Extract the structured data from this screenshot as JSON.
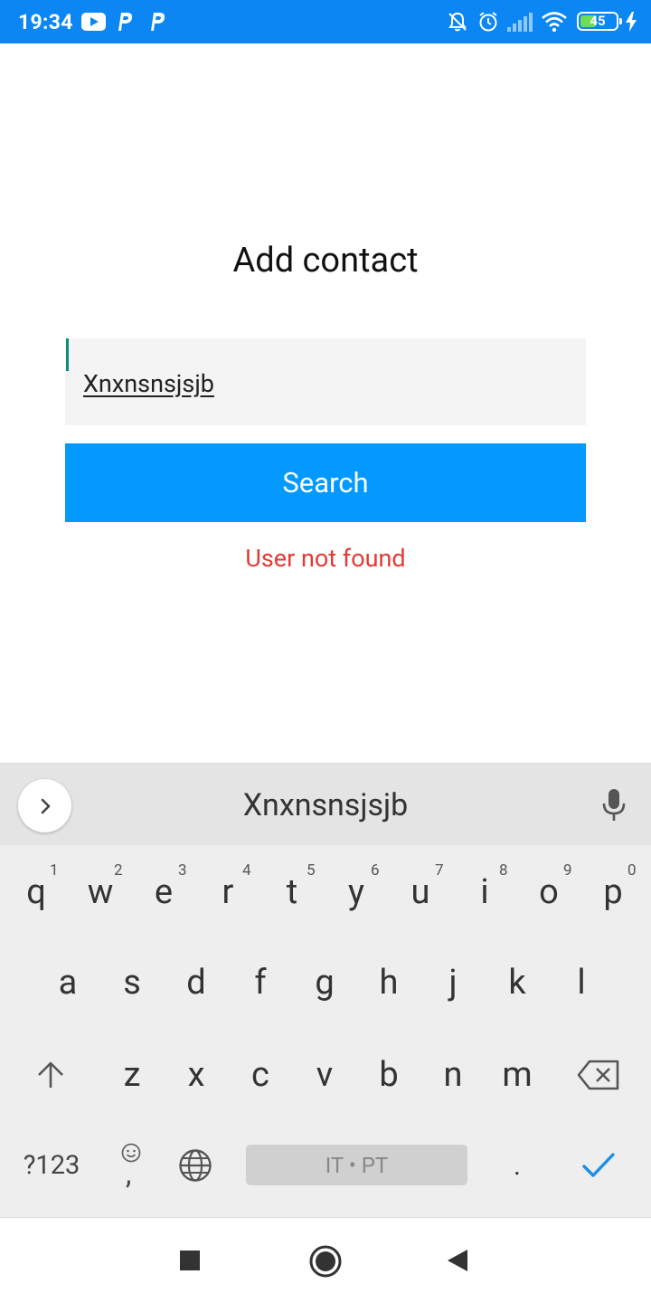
{
  "status_bar": {
    "time": "19:34",
    "battery_percent": "45",
    "battery_level": 0.45,
    "background_color": "#0b86f3",
    "icons": [
      "youtube-icon",
      "parking-p-icon",
      "parking-p-icon",
      "bell-off-icon",
      "alarm-clock-icon",
      "signal-icon",
      "wifi-icon",
      "battery-icon",
      "charging-bolt-icon"
    ]
  },
  "app": {
    "title": "Add contact",
    "search_input": {
      "value": "Xnxnsnsjsjb",
      "placeholder": ""
    },
    "search_button_label": "Search",
    "error_message": "User not found",
    "accent_color": "#0399fe",
    "error_color": "#e53935"
  },
  "keyboard": {
    "suggestion": "Xnxnsnsjsjb",
    "row1": [
      "q",
      "w",
      "e",
      "r",
      "t",
      "y",
      "u",
      "i",
      "o",
      "p"
    ],
    "row1_hints": [
      "1",
      "2",
      "3",
      "4",
      "5",
      "6",
      "7",
      "8",
      "9",
      "0"
    ],
    "row2": [
      "a",
      "s",
      "d",
      "f",
      "g",
      "h",
      "j",
      "k",
      "l"
    ],
    "row3": [
      "z",
      "x",
      "c",
      "v",
      "b",
      "n",
      "m"
    ],
    "symbols_label": "?123",
    "comma_label": ",",
    "spacebar_label": "IT • PT",
    "period_label": ".",
    "icons": [
      "chevron-right-icon",
      "microphone-icon",
      "shift-icon",
      "backspace-icon",
      "emoji-icon",
      "globe-icon",
      "checkmark-icon"
    ]
  },
  "nav_bar": {
    "icons": [
      "recents-square-icon",
      "home-circle-icon",
      "back-triangle-icon"
    ]
  }
}
